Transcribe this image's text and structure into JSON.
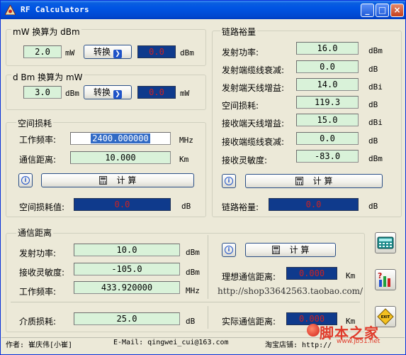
{
  "window": {
    "title": "RF Calculators",
    "buttons": {
      "minimize": "_",
      "maximize": "□",
      "close": "×"
    }
  },
  "mw_to_dbm": {
    "header": "mW 换算为 dBm",
    "input_value": "2.0",
    "input_unit": "mW",
    "convert_label": "转换",
    "output_value": "0.0",
    "output_unit": "dBm"
  },
  "dbm_to_mw": {
    "header": "d Bm 换算为 mW",
    "input_value": "3.0",
    "input_unit": "dBm",
    "convert_label": "转换",
    "output_value": "0.0",
    "output_unit": "mW"
  },
  "space_loss": {
    "header": "空间损耗",
    "freq_label": "工作频率:",
    "freq_value": "2400.000000",
    "freq_unit": "MHz",
    "dist_label": "通信距离:",
    "dist_value": "10.000",
    "dist_unit": "Km",
    "calc_label": "计 算",
    "result_label": "空间损耗值:",
    "result_value": "0.0",
    "result_unit": "dB"
  },
  "link_margin": {
    "header": "链路裕量",
    "rows": [
      {
        "label": "发射功率:",
        "value": "16.0",
        "unit": "dBm"
      },
      {
        "label": "发射端缆线衰减:",
        "value": "0.0",
        "unit": "dB"
      },
      {
        "label": "发射端天线增益:",
        "value": "14.0",
        "unit": "dBi"
      },
      {
        "label": "空间损耗:",
        "value": "119.3",
        "unit": "dB"
      },
      {
        "label": "接收端天线增益:",
        "value": "15.0",
        "unit": "dBi"
      },
      {
        "label": "接收端缆线衰减:",
        "value": "0.0",
        "unit": "dB"
      },
      {
        "label": "接收灵敏度:",
        "value": "-83.0",
        "unit": "dBm"
      }
    ],
    "calc_label": "计 算",
    "result_label": "链路裕量:",
    "result_value": "0.0",
    "result_unit": "dB"
  },
  "comm_distance": {
    "header": "通信距离",
    "tx_label": "发射功率:",
    "tx_value": "10.0",
    "tx_unit": "dBm",
    "sens_label": "接收灵敏度:",
    "sens_value": "-105.0",
    "sens_unit": "dBm",
    "freq_label": "工作频率:",
    "freq_value": "433.920000",
    "freq_unit": "MHz",
    "calc_label": "计 算",
    "ideal_label": "理想通信距离:",
    "ideal_value": "0.000",
    "ideal_unit": "Km",
    "link": "http://shop33642563.taobao.com/",
    "medium_label": "介质损耗:",
    "medium_value": "25.0",
    "medium_unit": "dB",
    "actual_label": "实际通信距离:",
    "actual_value": "0.000",
    "actual_unit": "Km"
  },
  "side_buttons": {
    "calculator": "calculator-icon",
    "chart": "chart-icon",
    "exit": "EXIT"
  },
  "status": {
    "author": "作者: 崔庆伟[小崔]",
    "email": "E-Mail:    qingwei_cui@163.com",
    "shop": "淘宝店铺: http://"
  },
  "watermark": {
    "text": "脚本之家",
    "url": "www.jb51.net"
  }
}
